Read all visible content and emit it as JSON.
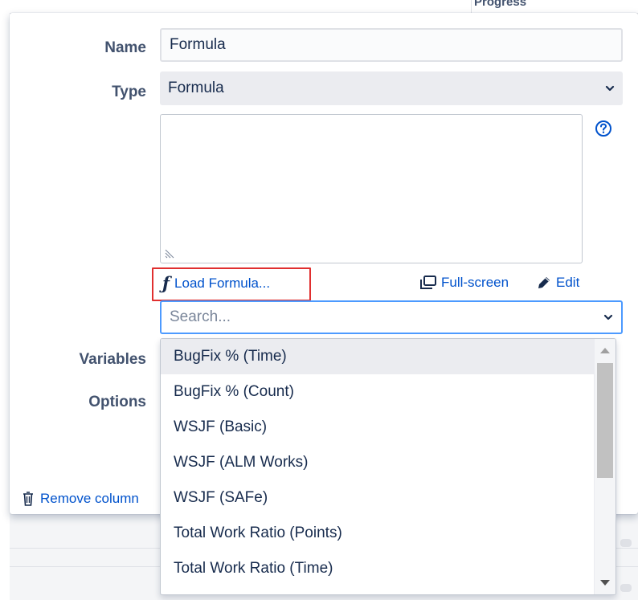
{
  "background": {
    "column_header": "Progress"
  },
  "form": {
    "name_label": "Name",
    "name_value": "Formula",
    "type_label": "Type",
    "type_value": "Formula",
    "variables_label": "Variables",
    "options_label": "Options"
  },
  "formula_editor": {
    "load_formula": "Load Formula...",
    "full_screen": "Full-screen",
    "edit": "Edit",
    "load_formula_icon": "function-icon",
    "full_screen_icon": "window-icon",
    "edit_icon": "pencil-icon",
    "help_icon": "question-circle-icon"
  },
  "search": {
    "placeholder": "Search..."
  },
  "dropdown": {
    "items": [
      {
        "label": "BugFix % (Time)"
      },
      {
        "label": "BugFix % (Count)"
      },
      {
        "label": "WSJF (Basic)"
      },
      {
        "label": "WSJF (ALM Works)"
      },
      {
        "label": "WSJF (SAFe)"
      },
      {
        "label": "Total Work Ratio (Points)"
      },
      {
        "label": "Total Work Ratio (Time)"
      }
    ],
    "highlighted_item": "BugFix % (Time)"
  },
  "footer": {
    "remove_column": "Remove column",
    "remove_icon": "trash-icon"
  },
  "colors": {
    "link": "#0052cc",
    "highlight_border": "#e02f2f",
    "focus_border": "#4c9aff",
    "label": "#42526e"
  }
}
